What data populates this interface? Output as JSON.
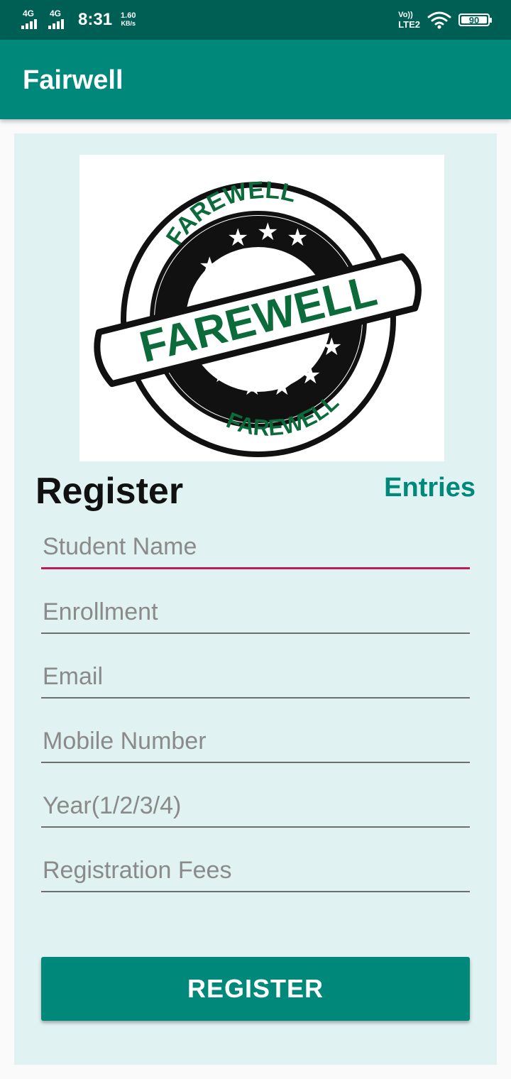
{
  "status_bar": {
    "network1": "4G",
    "network2": "4G",
    "time": "8:31",
    "speed_value": "1.60",
    "speed_unit": "KB/s",
    "volte": "Vo))",
    "lte": "LTE2",
    "battery": "90"
  },
  "app_bar": {
    "title": "Fairwell"
  },
  "logo": {
    "outer_text_top": "FAREWELL",
    "banner_text": "FAREWELL",
    "outer_text_bottom": "FAREWELL",
    "colors": {
      "green": "#0b6b3a",
      "black": "#111111"
    }
  },
  "form": {
    "heading": "Register",
    "entries_link": "Entries",
    "fields": {
      "student_name": "Student Name",
      "enrollment": "Enrollment",
      "email": "Email",
      "mobile": "Mobile Number",
      "year": "Year(1/2/3/4)",
      "fees": "Registration Fees"
    },
    "submit_label": "REGISTER"
  },
  "colors": {
    "primary": "#00897b",
    "primary_dark": "#005f55",
    "accent": "#c2185b",
    "card_background": "#e0f2f1"
  }
}
